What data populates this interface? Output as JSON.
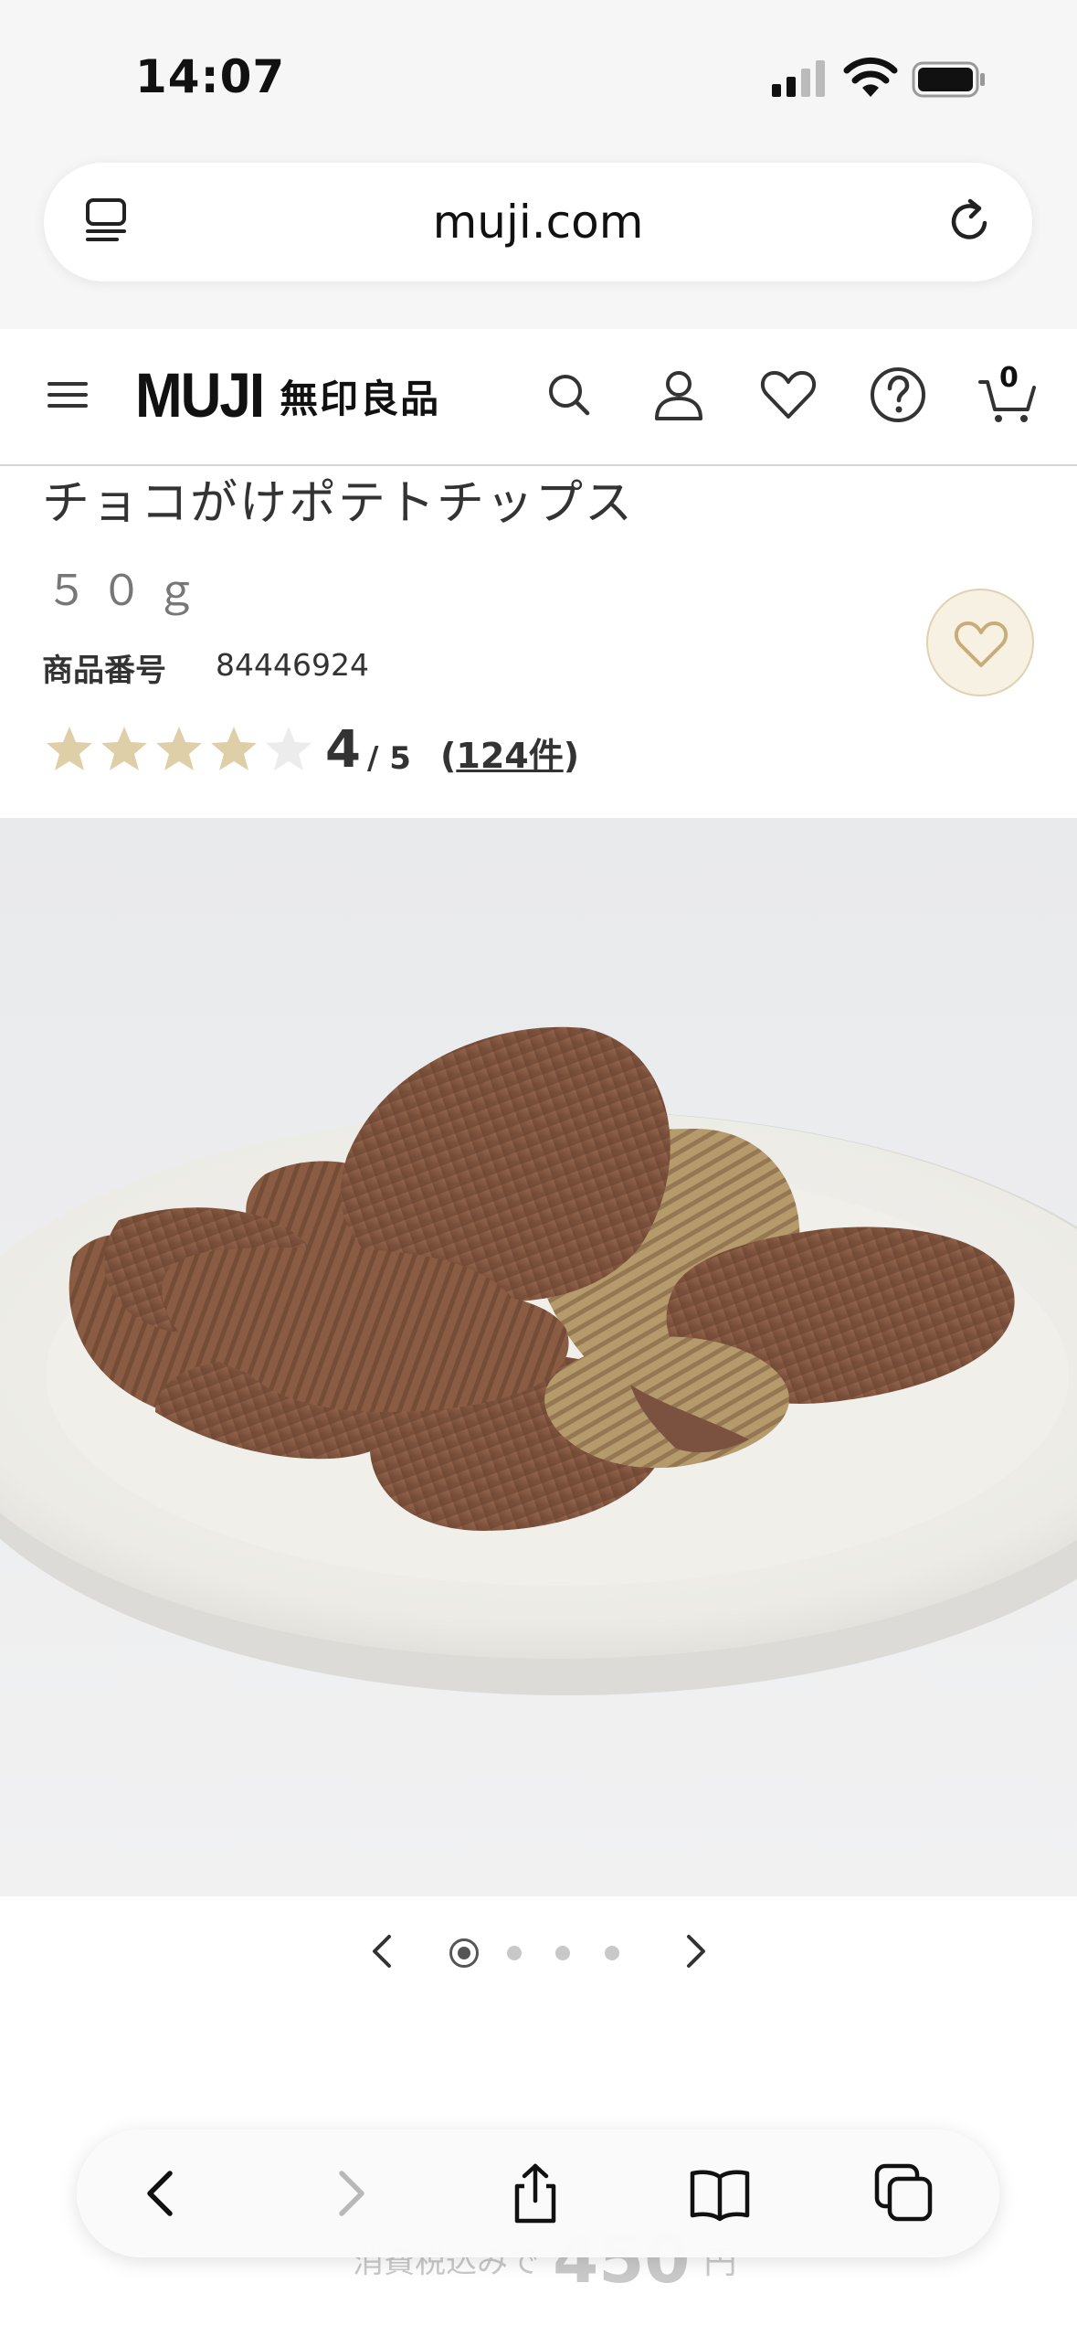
{
  "status_bar": {
    "time": "14:07"
  },
  "browser": {
    "url": "muji.com"
  },
  "header": {
    "logo_latin": "MUJI",
    "logo_japanese": "無印良品",
    "cart_count": "0"
  },
  "product": {
    "title": "チョコがけポテトチップス",
    "weight": "５０ｇ",
    "sku_label": "商品番号",
    "sku": "84446924",
    "rating": {
      "score": "4",
      "out_of": "/ 5",
      "stars_filled": 4,
      "stars_total": 5,
      "review_count": "124件"
    }
  },
  "gallery": {
    "image_count": 4,
    "active_index": 0,
    "image_name": "chocolate-coated-potato-chips-on-plate"
  },
  "price_peek": {
    "label": "消費税込みで",
    "amount": "450",
    "unit": "円"
  },
  "colors": {
    "accent_star": "#dfcfa8",
    "fav_bg": "#f7f1e3",
    "chocolate": "#8b5e46"
  }
}
